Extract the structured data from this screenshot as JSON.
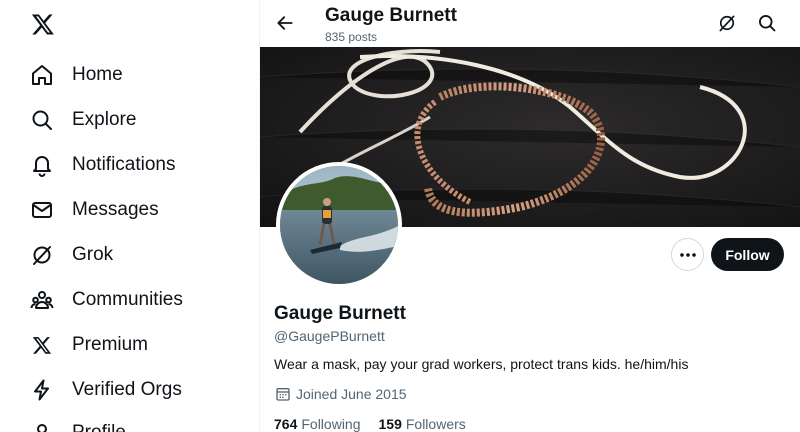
{
  "nav": {
    "items": [
      {
        "label": "Home",
        "icon": "home-icon"
      },
      {
        "label": "Explore",
        "icon": "search-icon"
      },
      {
        "label": "Notifications",
        "icon": "bell-icon"
      },
      {
        "label": "Messages",
        "icon": "envelope-icon"
      },
      {
        "label": "Grok",
        "icon": "grok-icon"
      },
      {
        "label": "Communities",
        "icon": "people-icon"
      },
      {
        "label": "Premium",
        "icon": "x-logo-icon"
      },
      {
        "label": "Verified Orgs",
        "icon": "lightning-icon"
      },
      {
        "label": "Profile",
        "icon": "person-icon"
      }
    ]
  },
  "header": {
    "name": "Gauge Burnett",
    "posts": "835 posts"
  },
  "profile": {
    "name": "Gauge Burnett",
    "handle": "@GaugePBurnett",
    "bio": "Wear a mask, pay your grad workers, protect trans kids. he/him/his",
    "joined": "Joined June 2015",
    "following_count": "764",
    "following_label": "Following",
    "followers_count": "159",
    "followers_label": "Followers"
  },
  "actions": {
    "follow_label": "Follow"
  },
  "colors": {
    "text": "#0f1419",
    "secondary": "#536471",
    "follow_bg": "#0f1419"
  }
}
